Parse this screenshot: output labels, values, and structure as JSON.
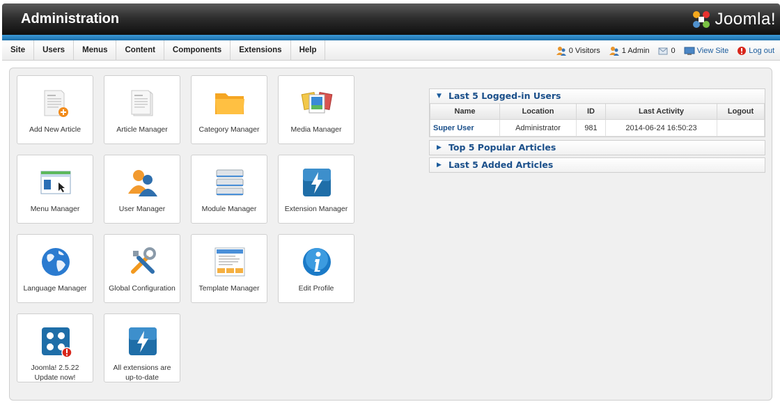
{
  "header": {
    "title": "Administration",
    "logo_text": "Joomla!"
  },
  "menu": [
    "Site",
    "Users",
    "Menus",
    "Content",
    "Components",
    "Extensions",
    "Help"
  ],
  "status": {
    "visitors": "0 Visitors",
    "admins": "1 Admin",
    "messages": "0",
    "view_site": "View Site",
    "logout": "Log out"
  },
  "tiles": [
    {
      "label": "Add New Article",
      "icon": "add-article-icon"
    },
    {
      "label": "Article Manager",
      "icon": "article-icon"
    },
    {
      "label": "Category Manager",
      "icon": "folder-icon"
    },
    {
      "label": "Media Manager",
      "icon": "media-icon"
    },
    {
      "label": "Menu Manager",
      "icon": "menu-window-icon"
    },
    {
      "label": "User Manager",
      "icon": "users-icon"
    },
    {
      "label": "Module Manager",
      "icon": "module-stack-icon"
    },
    {
      "label": "Extension Manager",
      "icon": "lightning-icon"
    },
    {
      "label": "Language Manager",
      "icon": "globe-icon"
    },
    {
      "label": "Global Configuration",
      "icon": "tools-icon"
    },
    {
      "label": "Template Manager",
      "icon": "template-icon"
    },
    {
      "label": "Edit Profile",
      "icon": "info-icon"
    },
    {
      "label_line1": "Joomla! 2.5.22",
      "label_line2": "Update now!",
      "icon": "joomla-update-icon"
    },
    {
      "label_line1": "All extensions are",
      "label_line2": "up-to-date",
      "icon": "lightning-icon"
    }
  ],
  "panels": {
    "logged_in": {
      "title": "Last 5 Logged-in Users",
      "columns": [
        "Name",
        "Location",
        "ID",
        "Last Activity",
        "Logout"
      ],
      "rows": [
        {
          "name": "Super User",
          "location": "Administrator",
          "id": "981",
          "last_activity": "2014-06-24 16:50:23",
          "logout": ""
        }
      ]
    },
    "popular": {
      "title": "Top 5 Popular Articles"
    },
    "added": {
      "title": "Last 5 Added Articles"
    }
  }
}
